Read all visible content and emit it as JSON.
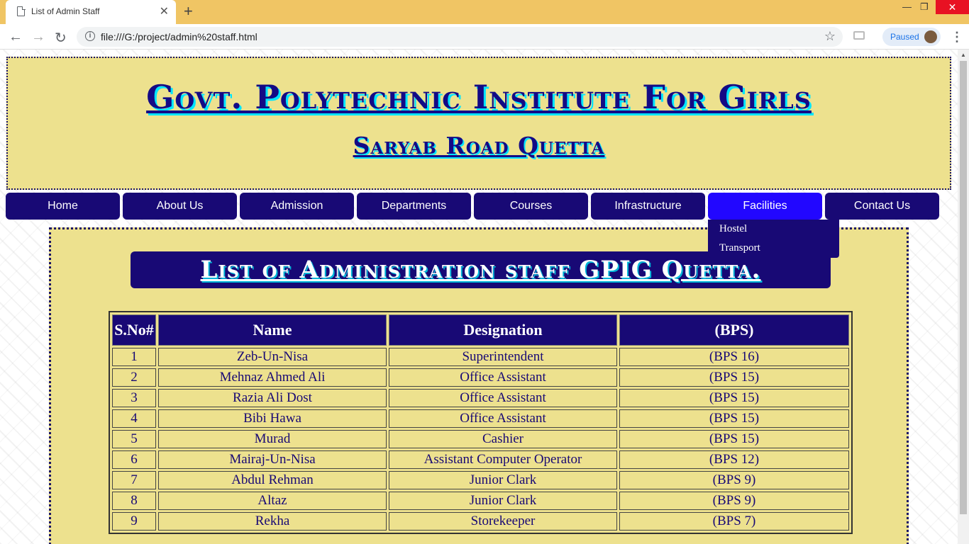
{
  "browser": {
    "tab_title": "List of Admin Staff",
    "url": "file:///G:/project/admin%20staff.html",
    "profile_status": "Paused"
  },
  "header": {
    "title": "Govt. Polytechnic Institute For Girls",
    "subtitle": "Saryab Road Quetta"
  },
  "nav": {
    "items": [
      "Home",
      "About Us",
      "Admission",
      "Departments",
      "Courses",
      "Infrastructure",
      "Facilities",
      "Contact Us"
    ],
    "active": "Facilities",
    "dropdown": [
      "Hostel",
      "Transport"
    ]
  },
  "main": {
    "heading": "List of Administration staff GPIG Quetta.",
    "table": {
      "headers": [
        "S.No#",
        "Name",
        "Designation",
        "(BPS)"
      ],
      "rows": [
        [
          "1",
          "Zeb-Un-Nisa",
          "Superintendent",
          "(BPS 16)"
        ],
        [
          "2",
          "Mehnaz Ahmed Ali",
          "Office Assistant",
          "(BPS 15)"
        ],
        [
          "3",
          "Razia Ali Dost",
          "Office Assistant",
          "(BPS 15)"
        ],
        [
          "4",
          "Bibi Hawa",
          "Office Assistant",
          "(BPS 15)"
        ],
        [
          "5",
          "Murad",
          "Cashier",
          "(BPS 15)"
        ],
        [
          "6",
          "Mairaj-Un-Nisa",
          "Assistant Computer Operator",
          "(BPS 12)"
        ],
        [
          "7",
          "Abdul Rehman",
          "Junior Clark",
          "(BPS 9)"
        ],
        [
          "8",
          "Altaz",
          "Junior Clark",
          "(BPS 9)"
        ],
        [
          "9",
          "Rekha",
          "Storekeeper",
          "(BPS 7)"
        ]
      ]
    }
  },
  "colors": {
    "nav_bg": "#180975",
    "nav_active": "#2207ff",
    "panel_bg": "#ede18e",
    "title_color": "#140a85",
    "title_shadow": "#00e5ff",
    "tabstrip": "#f0c564"
  },
  "icons": [
    "page-icon",
    "tab-close-icon",
    "new-tab-icon",
    "minimize-icon",
    "maximize-icon",
    "window-close-icon",
    "back-arrow-icon",
    "forward-arrow-icon",
    "reload-icon",
    "info-icon",
    "star-icon",
    "camera-icon",
    "profile-avatar",
    "menu-dots-icon"
  ]
}
